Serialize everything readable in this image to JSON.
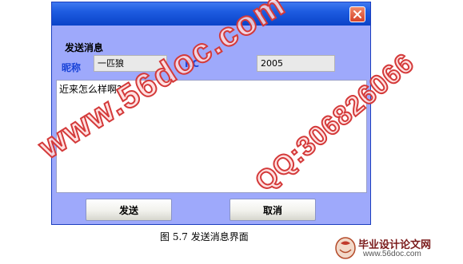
{
  "dialog": {
    "section_title": "发送消息",
    "nickname_label": "昵称",
    "nickname_value": "一匹狼",
    "rc_label": "RC",
    "rc_value": "2005",
    "message_text": "近来怎么样啊?",
    "send_label": "发送",
    "cancel_label": "取消"
  },
  "caption": "图 5.7  发送消息界面",
  "watermark": {
    "site": "www.56doc.com",
    "qq": "QQ:306826066"
  },
  "logo": {
    "title": "毕业设计论文网",
    "url": "www.56doc.com"
  },
  "colors": {
    "window_bg": "#9ea9fb",
    "titlebar": "#1d5be0",
    "close_button": "#d5432a",
    "label_blue": "#1a44d8",
    "watermark_red": "#d43a3a"
  },
  "icons": {
    "close": "close-icon",
    "logo": "logo-icon"
  }
}
